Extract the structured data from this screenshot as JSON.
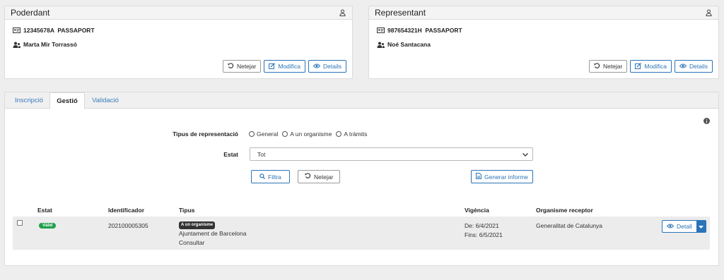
{
  "poderdant": {
    "title": "Poderdant",
    "document": "12345678A  PASSAPORT",
    "name": "Marta Mir Torrassó",
    "buttons": {
      "clear": "Netejar",
      "edit": "Modifica",
      "details": "Details"
    }
  },
  "representant": {
    "title": "Representant",
    "document": "987654321H  PASSAPORT",
    "name": "Noé Santacana",
    "buttons": {
      "clear": "Netejar",
      "edit": "Modifica",
      "details": "Details"
    }
  },
  "tabs": [
    "Inscripció",
    "Gestió",
    "Validació"
  ],
  "active_tab": "Gestió",
  "form": {
    "type_label": "Tipus de representació",
    "type_options": [
      "General",
      "A un organisme",
      "A tràmits"
    ],
    "state_label": "Estat",
    "state_value": "Tot",
    "filter_button": "Filtra",
    "clear_button": "Netejar",
    "report_button": "Generar informe"
  },
  "table": {
    "headers": [
      "Estat",
      "Identificador",
      "Tipus",
      "Vigència",
      "Organisme receptor"
    ],
    "rows": [
      {
        "state": "Vàlid",
        "id": "202100005305",
        "type_badge": "A un organisme",
        "type_line1": "Ajuntament de Barcelona",
        "type_line2": "Consultar",
        "from": "De: 6/4/2021",
        "to": "Fins: 6/5/2021",
        "organism": "Generalitat de Catalunya",
        "action": "Detall"
      }
    ]
  },
  "colors": {
    "link_blue": "#2a74b8",
    "valid_green": "#21a04a",
    "badge_dark": "#333333"
  }
}
